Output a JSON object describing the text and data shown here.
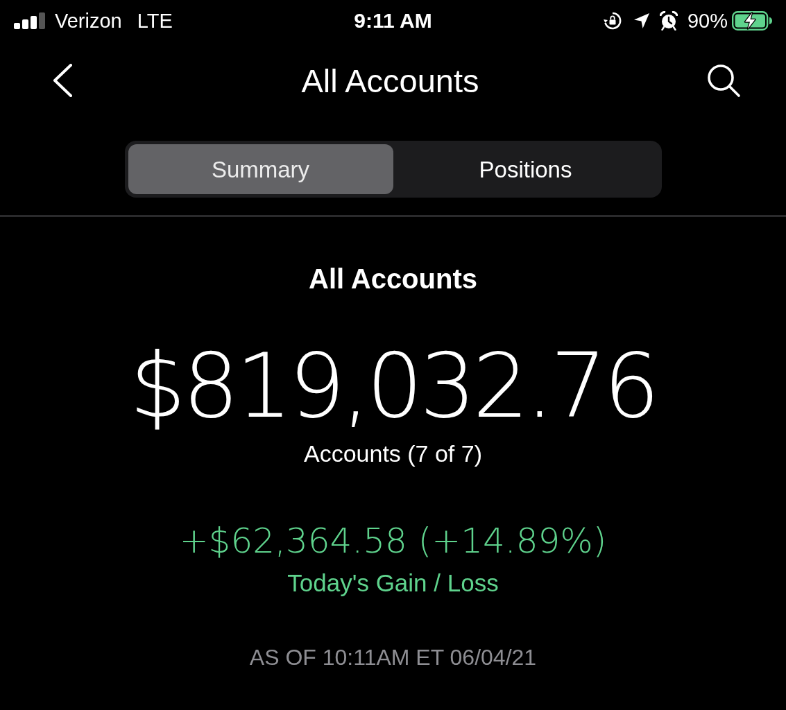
{
  "status_bar": {
    "carrier": "Verizon",
    "network": "LTE",
    "time": "9:11 AM",
    "battery_percent": "90%"
  },
  "nav": {
    "title": "All Accounts"
  },
  "tabs": [
    {
      "label": "Summary",
      "selected": true
    },
    {
      "label": "Positions",
      "selected": false
    }
  ],
  "summary": {
    "heading": "All Accounts",
    "total_value": "$819,032.76",
    "accounts_label": "Accounts (7 of 7)",
    "gain": "+$62,364.58 (+14.89%)",
    "gain_label": "Today's Gain / Loss",
    "as_of": "AS OF 10:11AM ET 06/04/21"
  }
}
